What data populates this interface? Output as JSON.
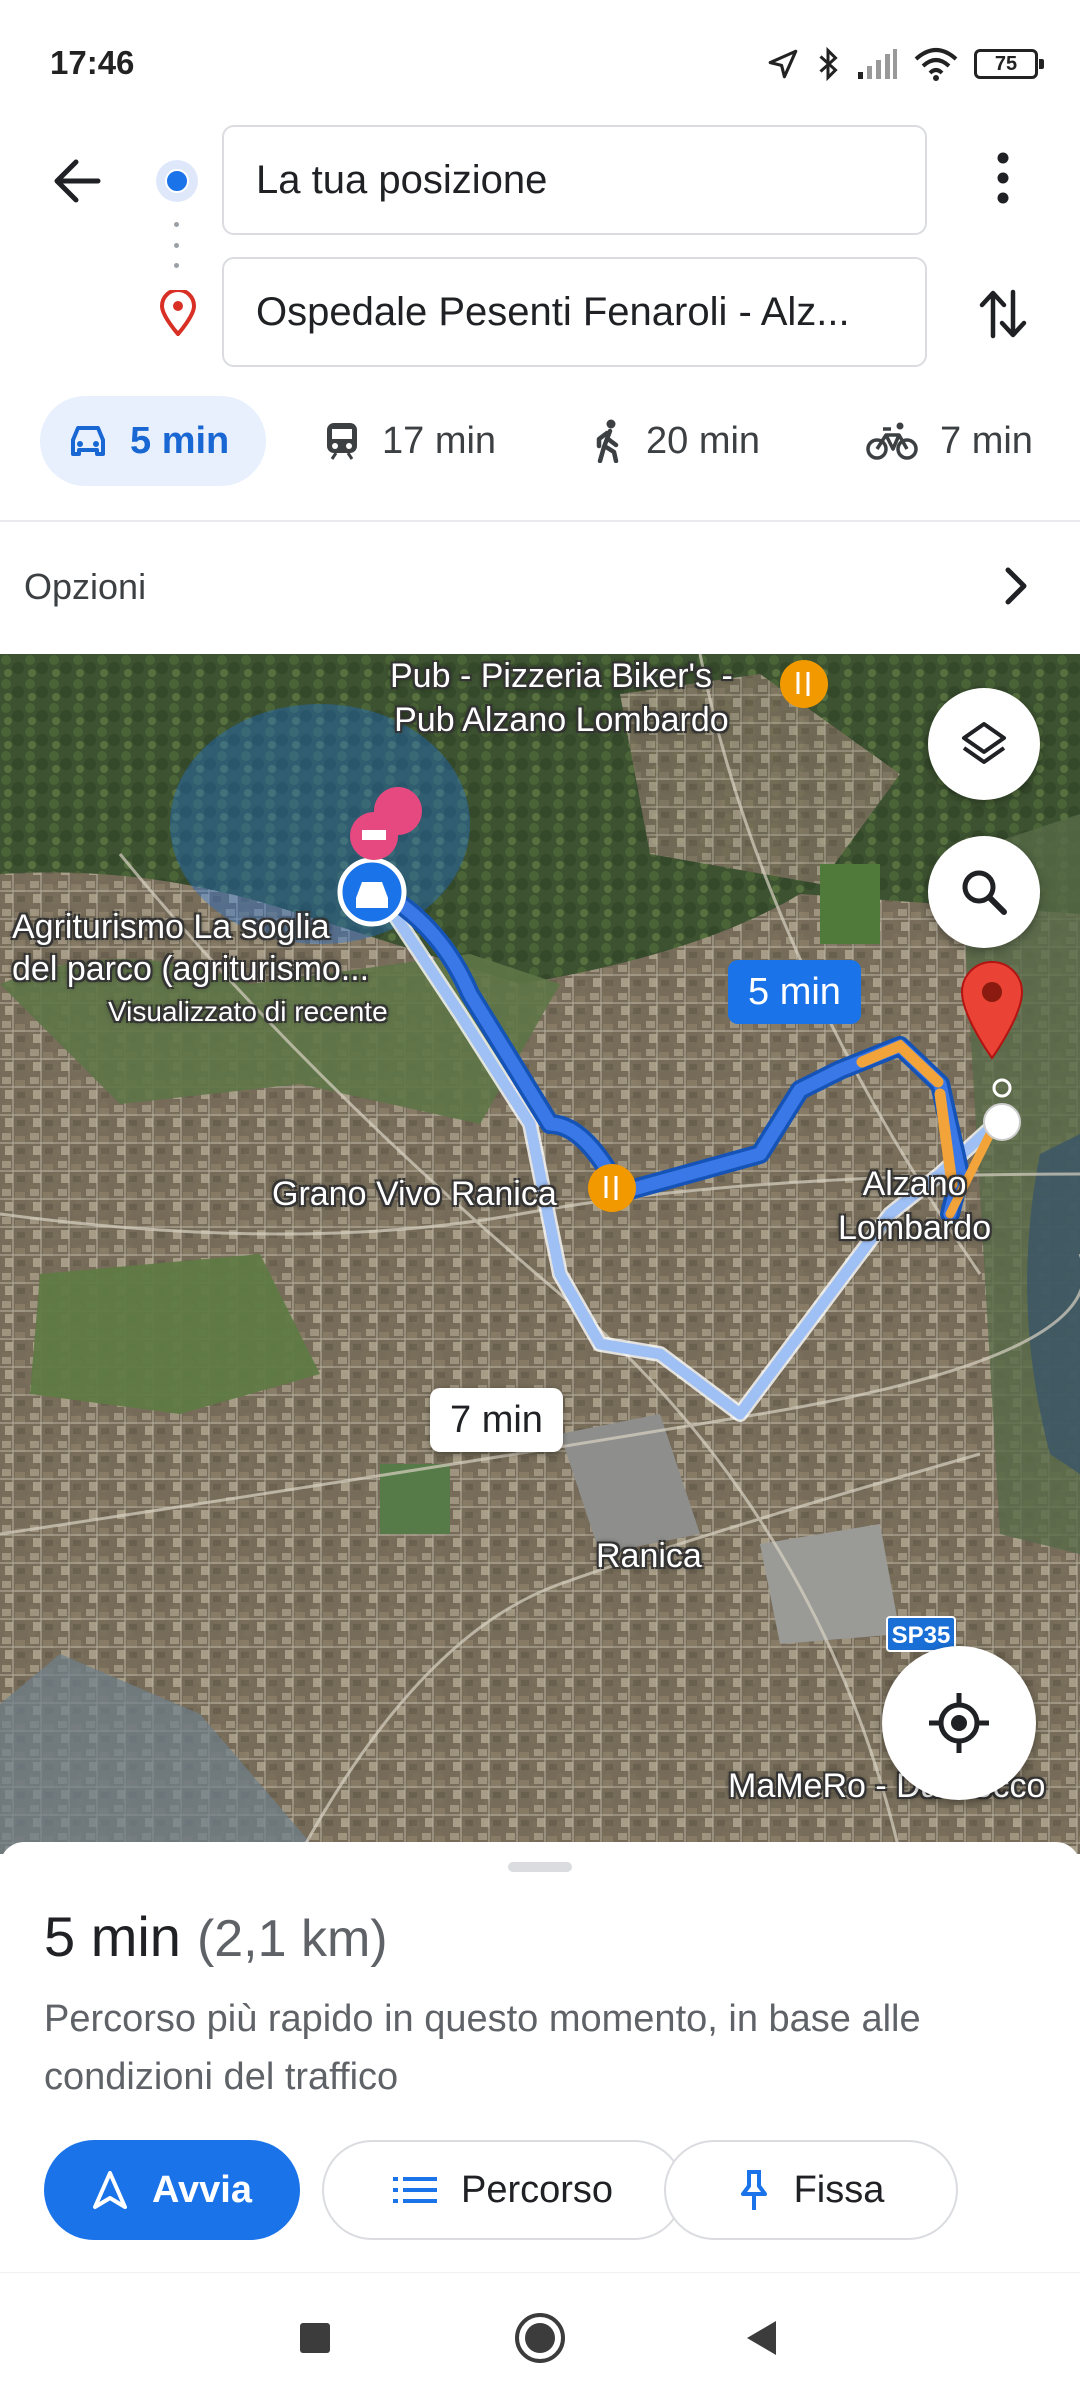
{
  "status_bar": {
    "time": "17:46",
    "battery": "75",
    "icons": [
      "location-arrow-icon",
      "bluetooth-icon",
      "signal-icon",
      "wifi-icon",
      "battery-icon"
    ]
  },
  "directions": {
    "origin_value": "La tua posizione",
    "destination_value": "Ospedale Pesenti Fenaroli - Alz..."
  },
  "modes": [
    {
      "name": "car",
      "icon": "car-icon",
      "label": "5 min",
      "selected": true
    },
    {
      "name": "transit",
      "icon": "train-icon",
      "label": "17 min",
      "selected": false
    },
    {
      "name": "walk",
      "icon": "walk-icon",
      "label": "20 min",
      "selected": false
    },
    {
      "name": "bike",
      "icon": "bike-icon",
      "label": "7 min",
      "selected": false
    }
  ],
  "options": {
    "label": "Opzioni"
  },
  "map": {
    "places": {
      "pub": "Pub - Pizzeria Biker's -\nPub Alzano Lombardo",
      "agriturismo": "Agriturismo La soglia\ndel parco (agriturismo...",
      "recent": "Visualizzato di recente",
      "grano": "Grano Vivo Ranica",
      "alzano": "Alzano\nLombardo",
      "ranica": "Ranica",
      "mamero": "MaMeRo - Da Rocco"
    },
    "road_shield": "SP35",
    "route_primary_time": "5 min",
    "route_alt_time": "7 min",
    "colors": {
      "route_primary": "#3b78e7",
      "route_alt": "#9ec0f5",
      "traffic": "#f2a33a",
      "destination_pin": "#ea4335"
    }
  },
  "sheet": {
    "duration": "5 min",
    "distance": "(2,1 km)",
    "description": "Percorso più rapido in questo momento, in base alle condizioni del traffico",
    "start_label": "Avvia",
    "route_label": "Percorso",
    "pin_label": "Fissa"
  },
  "nav_bar": {
    "icons": [
      "recents-square-icon",
      "home-circle-icon",
      "back-triangle-icon"
    ]
  }
}
